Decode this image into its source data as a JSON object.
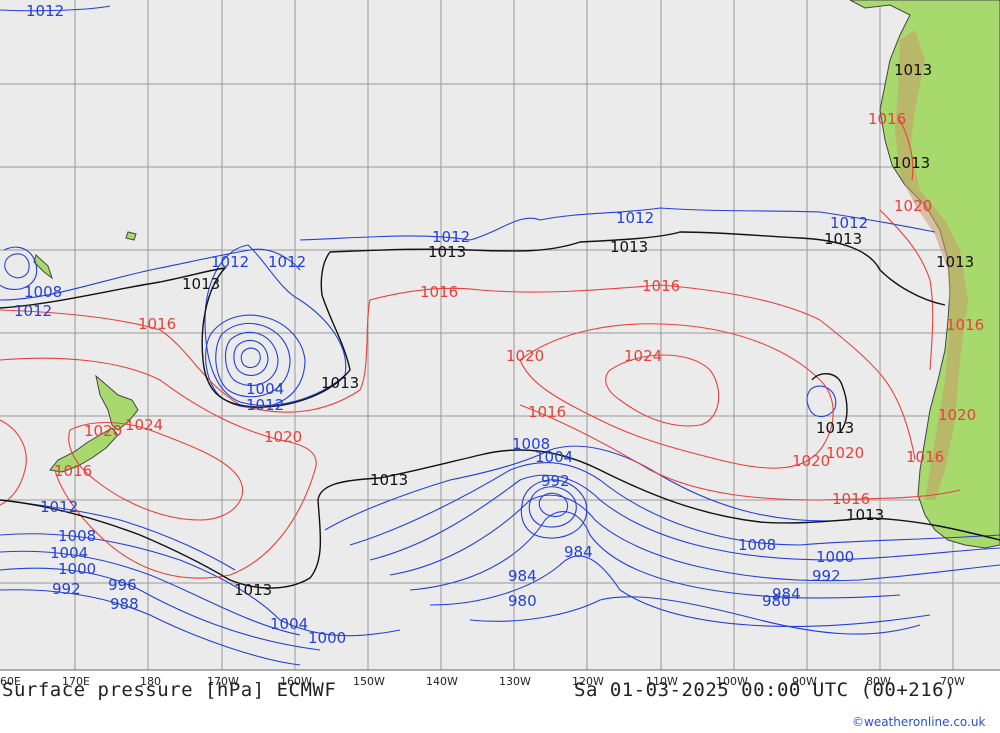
{
  "footer": {
    "title": "Surface pressure [hPa] ECMWF",
    "datetime": "Sa 01-03-2025 00:00 UTC (00+216)",
    "credit": "©weatheronline.co.uk"
  },
  "axis": {
    "lon_ticks": [
      "60E",
      "170E",
      "180",
      "170W",
      "160W",
      "150W",
      "140W",
      "130W",
      "120W",
      "110W",
      "100W",
      "90W",
      "80W",
      "70W"
    ]
  },
  "colors": {
    "ocean": "#ebebeb",
    "land": "#a7d96c",
    "grid": "#9a9a9a",
    "low_isobar": "#2340d8",
    "high_isobar": "#e8413a",
    "reference_isobar": "#111111"
  },
  "labels": {
    "blue": [
      "1012",
      "1012",
      "1012",
      "1012",
      "1012",
      "1008",
      "1012",
      "1004",
      "1012",
      "1008",
      "1004",
      "992",
      "984",
      "1008",
      "1012",
      "1008",
      "1004",
      "1000",
      "992",
      "996",
      "988",
      "1004",
      "1000",
      "984",
      "980",
      "1000",
      "992",
      "984",
      "980",
      "1012"
    ],
    "red": [
      "1016",
      "1016",
      "1016",
      "1020",
      "1024",
      "1016",
      "1020",
      "1024",
      "1020",
      "1016",
      "1020",
      "1020",
      "1016",
      "1016",
      "1016",
      "1020",
      "1020",
      "1016"
    ],
    "black": [
      "1013",
      "1013",
      "1013",
      "1013",
      "1013",
      "1013",
      "1013",
      "1013",
      "1013",
      "1013",
      "1013",
      "1013"
    ]
  }
}
